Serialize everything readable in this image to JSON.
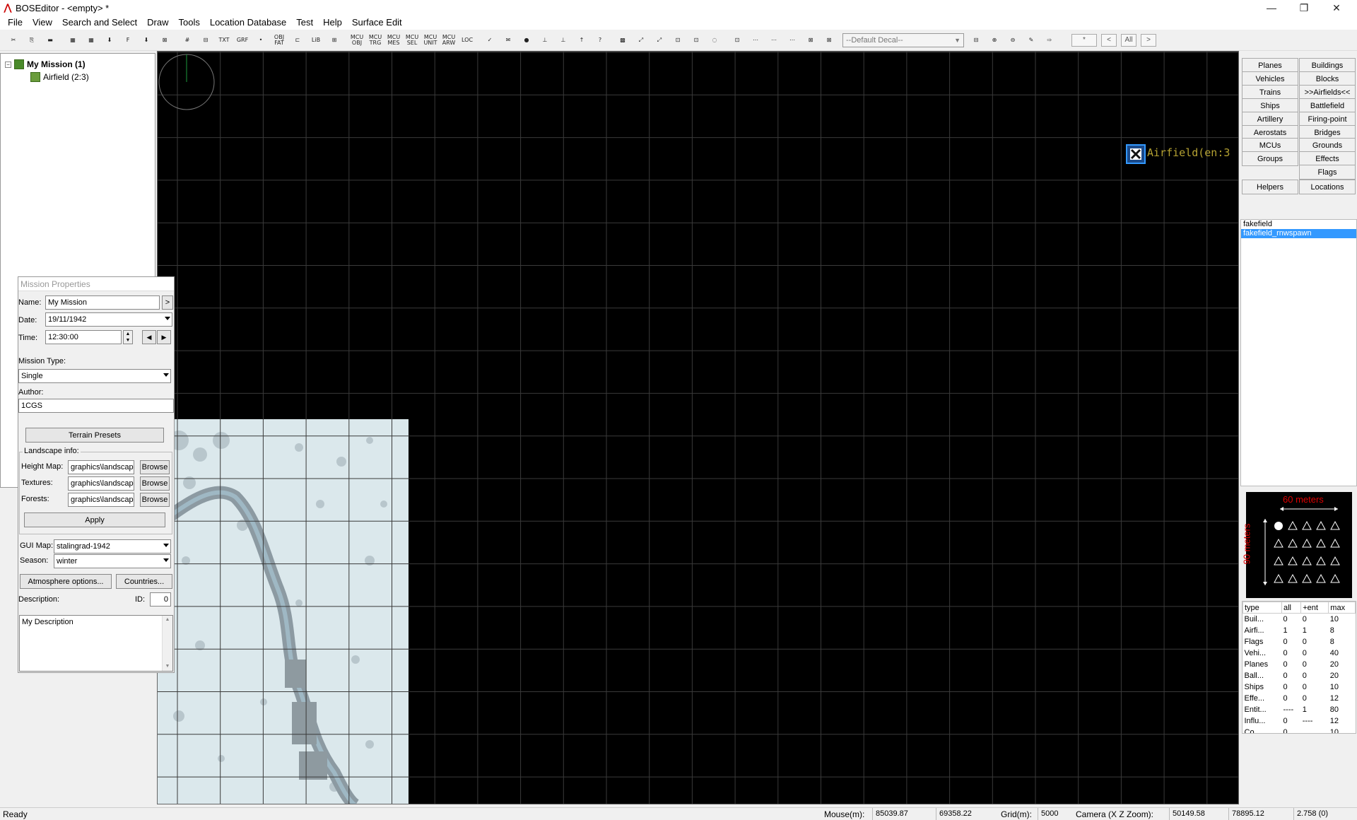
{
  "window": {
    "title": "BOSEditor - <empty> *",
    "minimize": "—",
    "maximize": "❐",
    "close": "✕"
  },
  "menu": [
    "File",
    "View",
    "Search and Select",
    "Draw",
    "Tools",
    "Location Database",
    "Test",
    "Help",
    "Surface Edit"
  ],
  "toolbar": {
    "buttons": [
      "✂",
      "⎘",
      "▬",
      "▦",
      "▦",
      "⬇",
      "F",
      "⬇",
      "⊠",
      "#",
      "⊟",
      "TXT",
      "GRF",
      "•",
      "OBJ FAT",
      "⊏",
      "LiB",
      "⊞",
      "MCU OBJ",
      "MCU TRG",
      "MCU MES",
      "MCU SEL",
      "MCU UNIT",
      "MCU ARW",
      "LOC",
      "✓",
      "✉",
      "●",
      "⊥",
      "⊥",
      "↑",
      "?",
      "▩",
      "⤢",
      "⤢",
      "⊡",
      "⊡",
      "◌",
      "⊡",
      "⋯",
      "⋯",
      "⋯",
      "⊠",
      "⊠"
    ],
    "decal_select": "--Default Decal--",
    "trailing": [
      "⊟",
      "⊕",
      "⊖",
      "✎",
      "⇨"
    ],
    "filter_field": "*",
    "nav": [
      "<",
      "All",
      ">"
    ]
  },
  "tree": {
    "root": "My Mission (1)",
    "child": "Airfield (2:3)"
  },
  "map": {
    "label": "Airfield(en:3"
  },
  "mission_properties": {
    "title": "Mission Properties",
    "name_label": "Name:",
    "name_value": "My Mission",
    "name_btn": ">",
    "date_label": "Date:",
    "date_value": "19/11/1942",
    "time_label": "Time:",
    "time_value": "12:30:00",
    "type_label": "Mission Type:",
    "type_value": "Single",
    "author_label": "Author:",
    "author_value": "1CGS",
    "terrain_presets": "Terrain Presets",
    "landscape_label": "Landscape info:",
    "height_label": "Height Map:",
    "height_value": "graphics\\landscape",
    "textures_label": "Textures:",
    "textures_value": "graphics\\landscape",
    "forests_label": "Forests:",
    "forests_value": "graphics\\landscape",
    "browse": "Browse",
    "apply": "Apply",
    "gui_map_label": "GUI Map:",
    "gui_map_value": "stalingrad-1942",
    "season_label": "Season:",
    "season_value": "winter",
    "atmosphere": "Atmosphere options...",
    "countries": "Countries...",
    "description_label": "Description:",
    "id_label": "ID:",
    "id_value": "0",
    "description_value": "My Description"
  },
  "right": {
    "buttons": [
      [
        "Planes",
        "Buildings"
      ],
      [
        "Vehicles",
        "Blocks"
      ],
      [
        "Trains",
        ">>Airfields<<"
      ],
      [
        "Ships",
        "Battlefield"
      ],
      [
        "Artillery",
        "Firing-point"
      ],
      [
        "Aerostats",
        "Bridges"
      ],
      [
        "MCUs",
        "Grounds"
      ],
      [
        "Groups",
        "Effects"
      ],
      [
        "",
        "Flags"
      ],
      [
        "Helpers",
        "Locations"
      ]
    ],
    "list": [
      "fakefield",
      "fakefield_rnwspawn"
    ],
    "selected_index": 1,
    "formation": {
      "width_label": "60 meters",
      "height_label": "90 meters"
    },
    "stats_headers": [
      "type",
      "all",
      "+ent",
      "max"
    ],
    "stats": [
      [
        "Buil...",
        "0",
        "0",
        "10"
      ],
      [
        "Airfi...",
        "1",
        "1",
        "8"
      ],
      [
        "Flags",
        "0",
        "0",
        "8"
      ],
      [
        "Vehi...",
        "0",
        "0",
        "40"
      ],
      [
        "Planes",
        "0",
        "0",
        "20"
      ],
      [
        "Ball...",
        "0",
        "0",
        "20"
      ],
      [
        "Ships",
        "0",
        "0",
        "10"
      ],
      [
        "Effe...",
        "0",
        "0",
        "12"
      ],
      [
        "Entit...",
        "----",
        "1",
        "80"
      ],
      [
        "Influ...",
        "0",
        "----",
        "12"
      ],
      [
        "Co...",
        "0",
        "",
        "10"
      ]
    ]
  },
  "status": {
    "ready": "Ready",
    "mouse_label": "Mouse(m):",
    "mouse_x": "85039.87",
    "mouse_z": "69358.22",
    "grid_label": "Grid(m):",
    "grid_value": "5000",
    "camera_label": "Camera (X Z Zoom):",
    "camera_x": "50149.58",
    "camera_z": "78895.12",
    "camera_zoom": "2.758 (0)"
  },
  "colors": {
    "map_bg": "#000000",
    "grid": "#3a3a3a",
    "airfield_label": "#b5a232",
    "selection": "#3399ff",
    "formation_text": "#e00000"
  }
}
